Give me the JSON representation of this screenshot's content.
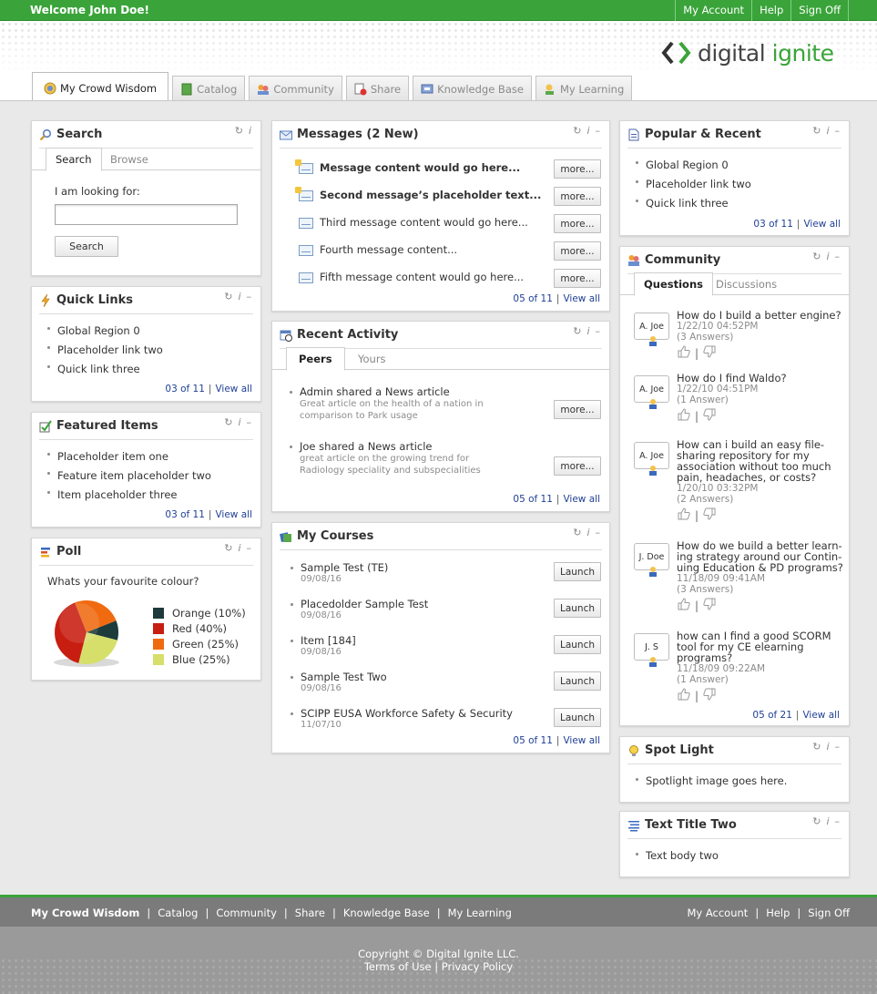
{
  "topbar": {
    "welcome": "Welcome John Doe!",
    "links": [
      "My Account",
      "Help",
      "Sign Off"
    ]
  },
  "logo": {
    "word_dark": "digital ",
    "word_green": "ignite"
  },
  "tabs": [
    "My Crowd Wisdom",
    "Catalog",
    "Community",
    "Share",
    "Knowledge Base",
    "My Learning"
  ],
  "search": {
    "title": "Search",
    "tabs": [
      "Search",
      "Browse"
    ],
    "label": "I am looking for:",
    "value": "",
    "button": "Search"
  },
  "quick_links": {
    "title": "Quick Links",
    "items": [
      "Global Region 0",
      "Placeholder link two",
      "Quick link three"
    ],
    "count": "03 of 11",
    "view_all": "View all"
  },
  "featured": {
    "title": "Featured Items",
    "items": [
      "Placeholder item one",
      "Feature item placeholder two",
      "Item placeholder three"
    ],
    "count": "03 of 11",
    "view_all": "View all"
  },
  "poll": {
    "title": "Poll",
    "question": "Whats your favourite colour?",
    "chart_data": {
      "type": "pie",
      "categories": [
        "Orange",
        "Red",
        "Green",
        "Blue"
      ],
      "values": [
        10,
        40,
        25,
        25
      ],
      "labels": [
        "Orange (10%)",
        "Red (40%)",
        "Green (25%)",
        "Blue (25%)"
      ],
      "colors": [
        "#1d3b3b",
        "#c81d11",
        "#f06a10",
        "#d6df6a"
      ]
    }
  },
  "messages": {
    "title": "Messages (2 New)",
    "items": [
      {
        "text": "Message content would go here...",
        "new": true
      },
      {
        "text": "Second message’s placeholder text...",
        "new": true
      },
      {
        "text": "Third message content would go here...",
        "new": false
      },
      {
        "text": "Fourth message content...",
        "new": false
      },
      {
        "text": "Fifth message content would go here...",
        "new": false
      }
    ],
    "more": "more...",
    "count": "05 of 11",
    "view_all": "View all"
  },
  "recent": {
    "title": "Recent Activity",
    "tabs": [
      "Peers",
      "Yours"
    ],
    "items": [
      {
        "title": "Admin shared a News article",
        "desc": "Great article on the health of a nation in comparison to Park usage",
        "desc1": "Great article on the health of a nation in",
        "desc2": "comparison to Park usage"
      },
      {
        "title": "Joe shared a News article",
        "desc1": "great article on the growing trend for",
        "desc2": "Radiology speciality and subspecialities"
      }
    ],
    "more": "more...",
    "count": "05 of 11",
    "view_all": "View all"
  },
  "courses": {
    "title": "My Courses",
    "items": [
      {
        "title": "Sample Test (TE)",
        "date": "09/08/16"
      },
      {
        "title": "Placedolder Sample Test",
        "date": "09/08/16"
      },
      {
        "title": "Item [184]",
        "date": "09/08/16"
      },
      {
        "title": "Sample Test Two",
        "date": "09/08/16"
      },
      {
        "title": "SCIPP EUSA Workforce Safety & Security",
        "date": "11/07/10"
      }
    ],
    "launch": "Launch",
    "count": "05 of 11",
    "view_all": "View all"
  },
  "popular": {
    "title": "Popular & Recent",
    "items": [
      "Global Region 0",
      "Placeholder link two",
      "Quick link three"
    ],
    "count": "03 of 11",
    "view_all": "View all"
  },
  "community": {
    "title": "Community",
    "tabs": [
      "Questions",
      "Discussions"
    ],
    "questions": [
      {
        "user": "A. Joe",
        "lines": [
          "How do I build a better engine?"
        ],
        "date": "1/22/10  04:52PM",
        "answers": "(3 Answers)"
      },
      {
        "user": "A. Joe",
        "lines": [
          "How do I find Waldo?"
        ],
        "date": "1/22/10  04:51PM",
        "answers": "(1 Answer)"
      },
      {
        "user": "A. Joe",
        "lines": [
          "How can i build an easy file-",
          "sharing repository for my",
          "association without too much",
          "pain, headaches, or costs?"
        ],
        "date": "1/20/10  03:32PM",
        "answers": "(2 Answers)"
      },
      {
        "user": "J. Doe",
        "lines": [
          "How do we build a better learn-",
          "ing strategy around our Contin-",
          "uing Education & PD programs?"
        ],
        "date": "11/18/09  09:41AM",
        "answers": "(3 Answers)"
      },
      {
        "user": "J. S",
        "lines": [
          "how can I find a good SCORM",
          "tool for my CE elearning",
          "programs?"
        ],
        "date": "11/18/09  09:22AM",
        "answers": "(1 Answer)"
      }
    ],
    "count": "05 of 21",
    "view_all": "View all"
  },
  "spotlight": {
    "title": "Spot Light",
    "items": [
      "Spotlight image goes here."
    ]
  },
  "text_two": {
    "title": "Text Title Two",
    "items": [
      "Text body two"
    ]
  },
  "footer": {
    "nav": [
      "My Crowd Wisdom",
      "Catalog",
      "Community",
      "Share",
      "Knowledge Base",
      "My Learning"
    ],
    "right": [
      "My Account",
      "Help",
      "Sign Off"
    ],
    "copyright": "Copyright © Digital Ignite LLC.",
    "terms": "Terms of Use",
    "privacy": "Privacy Policy"
  },
  "colors": {
    "brand_green": "#3aa43a",
    "link_blue": "#1f3f95"
  }
}
